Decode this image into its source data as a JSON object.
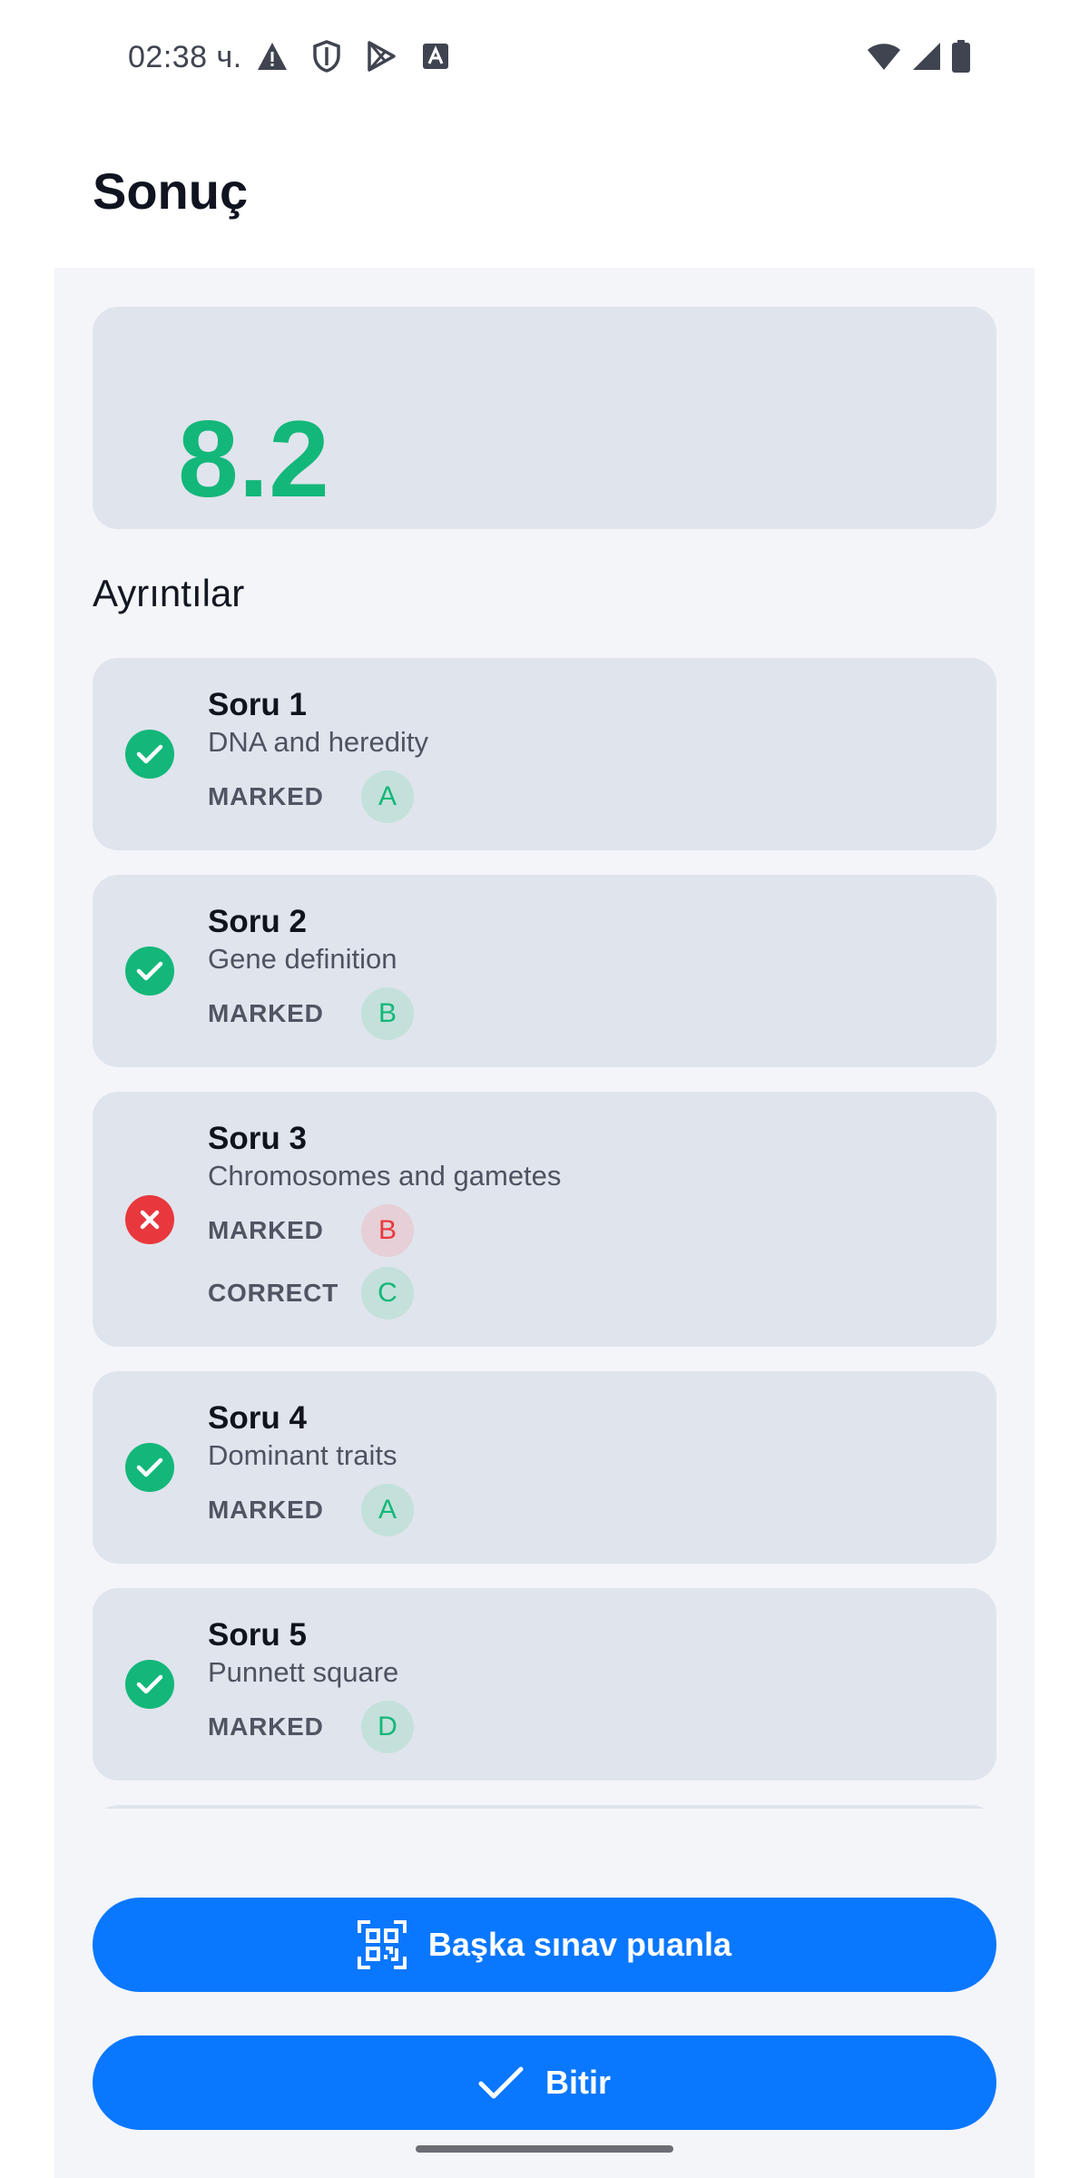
{
  "status_bar": {
    "time": "02:38 ч.",
    "icons": [
      "warning-icon",
      "shield-icon",
      "play-store-icon",
      "translate-icon",
      "wifi-icon",
      "cell-signal-icon",
      "battery-icon"
    ]
  },
  "page": {
    "title": "Sonuç"
  },
  "score": {
    "value": "8.2",
    "color": "#13b77a"
  },
  "details": {
    "title": "Ayrıntılar",
    "questions": [
      {
        "title": "Soru 1",
        "topic": "DNA and heredity",
        "status": "correct",
        "marked_label": "MARKED",
        "marked": "A"
      },
      {
        "title": "Soru 2",
        "topic": "Gene definition",
        "status": "correct",
        "marked_label": "MARKED",
        "marked": "B"
      },
      {
        "title": "Soru 3",
        "topic": "Chromosomes and gametes",
        "status": "wrong",
        "marked_label": "MARKED",
        "marked": "B",
        "correct_label": "CORRECT",
        "correct": "C"
      },
      {
        "title": "Soru 4",
        "topic": "Dominant traits",
        "status": "correct",
        "marked_label": "MARKED",
        "marked": "A"
      },
      {
        "title": "Soru 5",
        "topic": "Punnett square",
        "status": "correct",
        "marked_label": "MARKED",
        "marked": "D"
      }
    ]
  },
  "actions": {
    "scan_another": {
      "label": "Başka sınav puanla",
      "icon": "qr-scan-icon"
    },
    "finish": {
      "label": "Bitir",
      "icon": "check-icon"
    }
  },
  "colors": {
    "accent": "#0a77ff",
    "correct": "#13b77a",
    "wrong": "#e8383d",
    "card": "#e0e4ec"
  }
}
